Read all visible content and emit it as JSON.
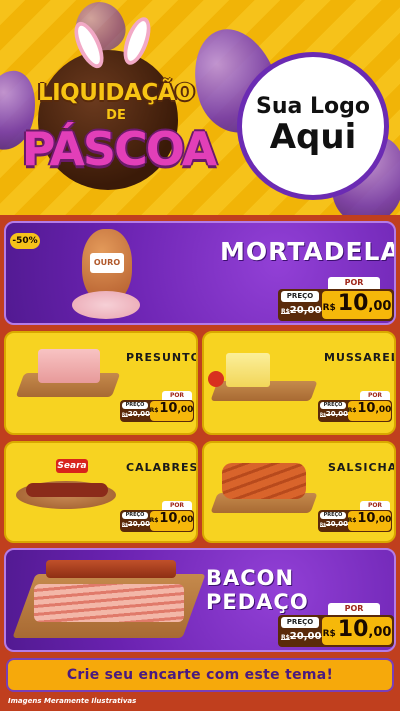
{
  "header": {
    "title_line1": "LIQUIDAÇÃO",
    "title_line2": "DE",
    "title_line3": "PÁSCOA",
    "logo_line1": "Sua Logo",
    "logo_line2": "Aqui"
  },
  "badge": "-50%",
  "price_labels": {
    "preco": "PREÇO",
    "por": "POR",
    "currency": "R$"
  },
  "products": {
    "mortadela": {
      "name": "MORTADELA",
      "brand": "OURO",
      "old_price": "20,00",
      "new_int": "10",
      "new_dec": ",00"
    },
    "presunto": {
      "name": "PRESUNTO",
      "old_price": "20,00",
      "new_int": "10",
      "new_dec": ",00"
    },
    "mussarela": {
      "name": "MUSSARELA",
      "old_price": "20,00",
      "new_int": "10",
      "new_dec": ",00"
    },
    "calabresa": {
      "name": "CALABRESA",
      "brand": "Seara",
      "old_price": "20,00",
      "new_int": "10",
      "new_dec": ",00"
    },
    "salsicha": {
      "name": "SALSICHA",
      "old_price": "20,00",
      "new_int": "10",
      "new_dec": ",00"
    },
    "bacon": {
      "name": "BACON PEDAÇO",
      "old_price": "20,00",
      "new_int": "10",
      "new_dec": ",00"
    }
  },
  "footer": {
    "cta": "Crie seu encarte com este tema!",
    "disclaimer": "Imagens Meramente Ilustrativas"
  },
  "colors": {
    "purple": "#6a22b0",
    "yellow": "#f7d321",
    "orange": "#f6b80a",
    "brown": "#5a2a0a",
    "pink": "#e23fb8"
  }
}
